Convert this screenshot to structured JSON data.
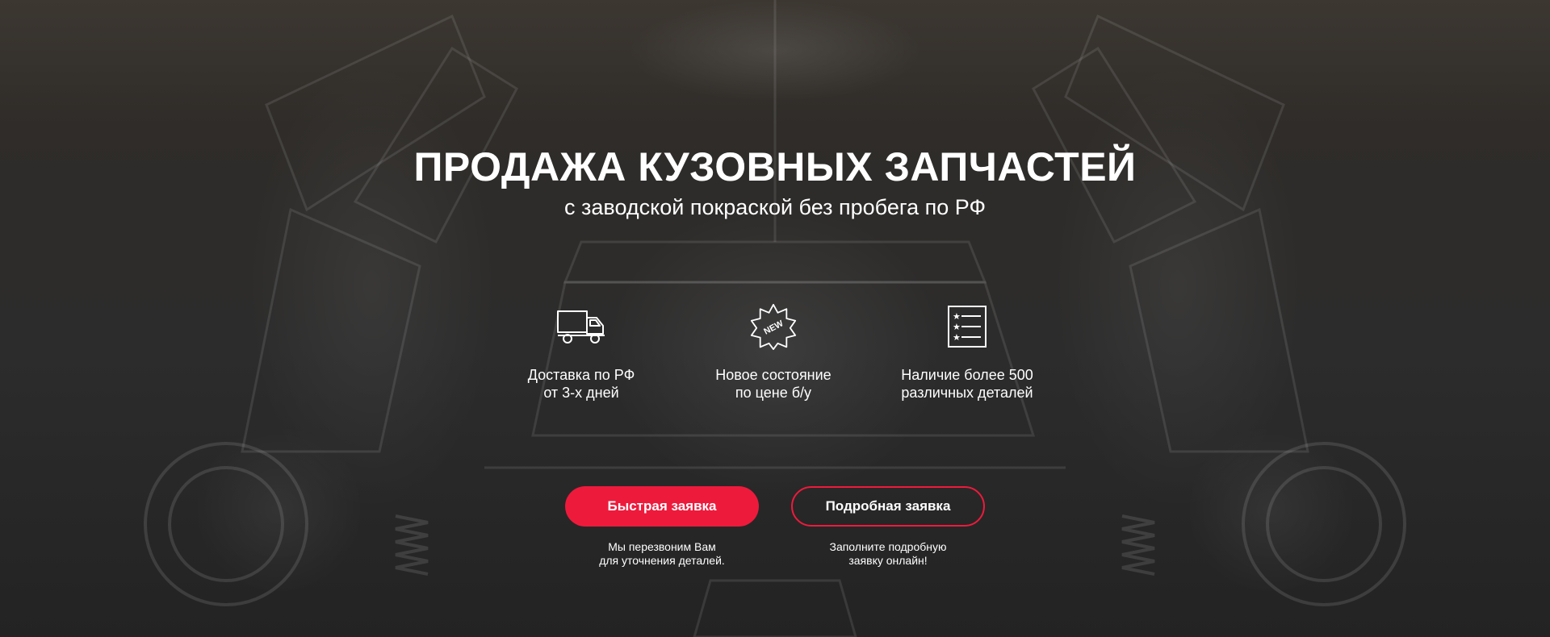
{
  "hero": {
    "title": "ПРОДАЖА КУЗОВНЫХ ЗАПЧАСТЕЙ",
    "subtitle": "с заводской покраской без пробега по РФ"
  },
  "features": [
    {
      "icon": "truck-icon",
      "line1": "Доставка по РФ",
      "line2": "от 3-х дней"
    },
    {
      "icon": "new-badge-icon",
      "badge_text": "NEW",
      "line1": "Новое состояние",
      "line2": "по цене б/у"
    },
    {
      "icon": "checklist-icon",
      "line1": "Наличие более 500",
      "line2": "различных деталей"
    }
  ],
  "buttons": {
    "quick": {
      "label": "Быстрая заявка",
      "note_line1": "Мы перезвоним Вам",
      "note_line2": "для уточнения деталей."
    },
    "detailed": {
      "label": "Подробная заявка",
      "note_line1": "Заполните подробную",
      "note_line2": "заявку онлайн!"
    }
  },
  "colors": {
    "accent": "#ee1a3c",
    "overlay": "#2b2b2b",
    "text": "#ffffff"
  }
}
